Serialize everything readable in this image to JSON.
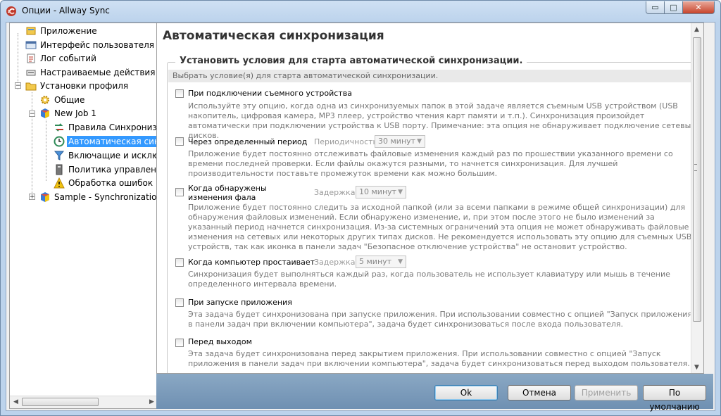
{
  "window": {
    "title": "Опции - Allway Sync",
    "controls": {
      "minimize": "▭",
      "maximize": "□",
      "close": "✕"
    }
  },
  "tree": {
    "items": [
      {
        "label": "Приложение",
        "icon": "app-icon"
      },
      {
        "label": "Интерфейс пользователя",
        "icon": "ui-icon"
      },
      {
        "label": "Лог событий",
        "icon": "log-icon"
      },
      {
        "label": "Настраиваемые действия",
        "icon": "actions-icon"
      },
      {
        "label": "Установки профиля",
        "icon": "profile-folder-icon"
      },
      {
        "label": "Общие",
        "icon": "gear-icon"
      },
      {
        "label": "New Job 1",
        "icon": "job-cube-icon"
      },
      {
        "label": "Правила Синхронизац",
        "icon": "sync-arrows-icon"
      },
      {
        "label": "Автоматическая синхр",
        "icon": "clock-icon"
      },
      {
        "label": "Включащие и исключа",
        "icon": "filter-icon"
      },
      {
        "label": "Политика управления",
        "icon": "file-policy-icon"
      },
      {
        "label": "Обработка ошибок",
        "icon": "warning-icon"
      },
      {
        "label": "Sample - Synchronization w",
        "icon": "job-cube-icon"
      }
    ]
  },
  "content": {
    "title": "Автоматическая синхронизация",
    "group_title": "Установить условия для старта автоматической синхронизации.",
    "group_hint": "Выбрать условие(я) для старта автоматической синхронизации.",
    "options": [
      {
        "label": "При подключении съемного устройства",
        "description": "Используйте эту опцию, когда одна из синхронизуемых папок в этой задаче является съемным USB устройством (USB накопитель, цифровая камера, MP3 плеер, устройство чтения карт памяти и т.п.). Синхронизация произойдет автоматически при подключении устройства к USB порту. Примечание: эта опция не обнаруживает подключение сетевых дисков."
      },
      {
        "label": "Через определенный период",
        "param_label": "Периодичность:",
        "param_value": "30 минут",
        "description": "Приложение будет постоянно отслеживать файловые изменения каждый раз по прошествии указанного времени со времени последней проверки. Если файлы окажутся разными, то начнется синхронизация. Для лучшей производительности поставьте промежуток времени как можно большим."
      },
      {
        "label": "Когда обнаружены изменения фала",
        "param_label": "Задержка:",
        "param_value": "10 минут",
        "description": "Приложение будет постоянно следить за исходной папкой (или за всеми папками в режиме общей синхронизации) для обнаружения файловых изменений. Если обнаружено изменение, и, при этом после этого не было изменений за указанный период начнется синхронизация. Из-за системных ограничений эта опция не может обнаруживать файловые изменения на сетевых или некоторых других типах дисков. Не рекомендуется использовать эту опцию для съемных USB устройств, так как иконка в панели задач \"Безопасное отключение устройства\" не остановит устройство."
      },
      {
        "label": "Когда компьютер простаивает",
        "param_label": "Задержка:",
        "param_value": "5 минут",
        "description": "Синхронизация будет выполняться каждый раз, когда пользователь не использует клавиатуру или мышь в течение определенного интервала времени."
      },
      {
        "label": "При запуске приложения",
        "description": "Эта задача будет синхронизована при запуске приложения. При использовании совместно с опцией \"Запуск приложения в панели задач при включении компьютера\", задача будет синхронизоваться после входа пользователя."
      },
      {
        "label": "Перед выходом",
        "description": "Эта задача будет синхронизована перед закрытием приложения. При использовании совместно с опцией \"Запуск приложения в панели задач при включении компьютера\", задача будет синхронизоваться перед выходом пользователя."
      }
    ]
  },
  "buttons": {
    "ok": "Ok",
    "cancel": "Отмена",
    "apply": "Применить",
    "defaults": "По умолчанию"
  }
}
